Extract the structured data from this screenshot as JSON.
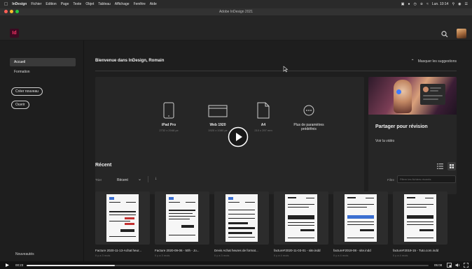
{
  "menubar": {
    "app": "InDesign",
    "items": [
      "Fichier",
      "Edition",
      "Page",
      "Texte",
      "Objet",
      "Tableau",
      "Affichage",
      "Fenêtre",
      "Aide"
    ],
    "clock": "Lun. 10:14"
  },
  "window": {
    "title": "Adobe InDesign 2021"
  },
  "header": {
    "logo": "Id"
  },
  "sidebar": {
    "items": [
      {
        "label": "Accueil",
        "active": true
      },
      {
        "label": "Formation",
        "active": false
      }
    ],
    "create_button": "Créer nouveau",
    "open_button": "Ouvrir",
    "new_label": "Nouveautés"
  },
  "main": {
    "welcome": "Bienvenue dans InDesign, Romain",
    "hide_suggestions": "Masquer les suggestions",
    "presets": [
      {
        "label": "iPad Pro",
        "sub": "2732 x 2048 px"
      },
      {
        "label": "Web 1920",
        "sub": "1920 x 1080 px"
      },
      {
        "label": "A4",
        "sub": "210 x 297 mm"
      },
      {
        "label": "Plus de paramètres prédéfinis",
        "sub": ""
      }
    ],
    "share": {
      "title": "Partager pour révision",
      "link": "Voir la vidéo"
    },
    "recent": {
      "title": "Récent",
      "sort_label": "Trier",
      "sort_value": "Récent",
      "filter_label": "Filtre",
      "filter_placeholder": "Filtrer les fichiers récents",
      "files": [
        {
          "name": "Facture 2020-11-13-Achat heur...",
          "date": "Il y a 3 mois"
        },
        {
          "name": "Facture 2020-09-06 - 50h - Jo...",
          "date": "Il y a 3 mois"
        },
        {
          "name": "Devis Achat heures de format...",
          "date": "Il y a 3 mois"
        },
        {
          "name": "factureF2020-11-03-01 - site.indd",
          "date": "Il y a 4 mois"
        },
        {
          "name": "factureF2019-08 - site.indd",
          "date": "Il y a 4 mois"
        },
        {
          "name": "factureF2019-15 - Tuto.com.indd",
          "date": "Il y a 4 mois"
        }
      ]
    }
  },
  "video": {
    "current_time": "00:23",
    "end_time": "05:08",
    "progress": 0.22
  },
  "colors": {
    "accent": "#ff3366",
    "logo_bg": "#3b0a21",
    "background": "#1e1e1e"
  }
}
